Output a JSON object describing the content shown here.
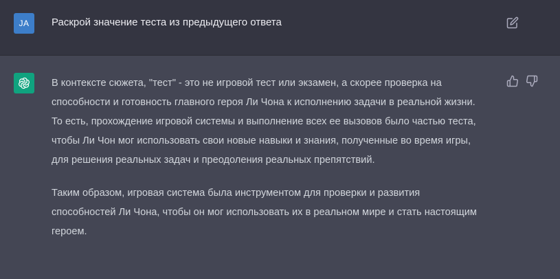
{
  "user_message": {
    "avatar_initials": "JA",
    "text": "Раскрой значение теста из предыдущего ответа",
    "edit_icon": "pencil-square-icon"
  },
  "assistant_message": {
    "avatar_icon": "openai-logo-icon",
    "paragraphs": [
      "В контексте сюжета, \"тест\" - это не игровой тест или экзамен, а скорее проверка на способности и готовность главного героя Ли Чона к исполнению задачи в реальной жизни. То есть, прохождение игровой системы и выполнение всех ее вызовов было частью теста, чтобы Ли Чон мог использовать свои новые навыки и знания, полученные во время игры, для решения реальных задач и преодоления реальных препятствий.",
      "Таким образом, игровая система была инструментом для проверки и развития способностей Ли Чона, чтобы он мог использовать их в реальном мире и стать настоящим героем."
    ],
    "feedback_icons": [
      "thumbs-up-icon",
      "thumbs-down-icon"
    ]
  },
  "colors": {
    "user_bg": "#343541",
    "assistant_bg": "#444654",
    "user_avatar": "#3d7ec9",
    "bot_avatar": "#10a37f",
    "text": "#d1d5db",
    "icon": "#acacbe"
  }
}
